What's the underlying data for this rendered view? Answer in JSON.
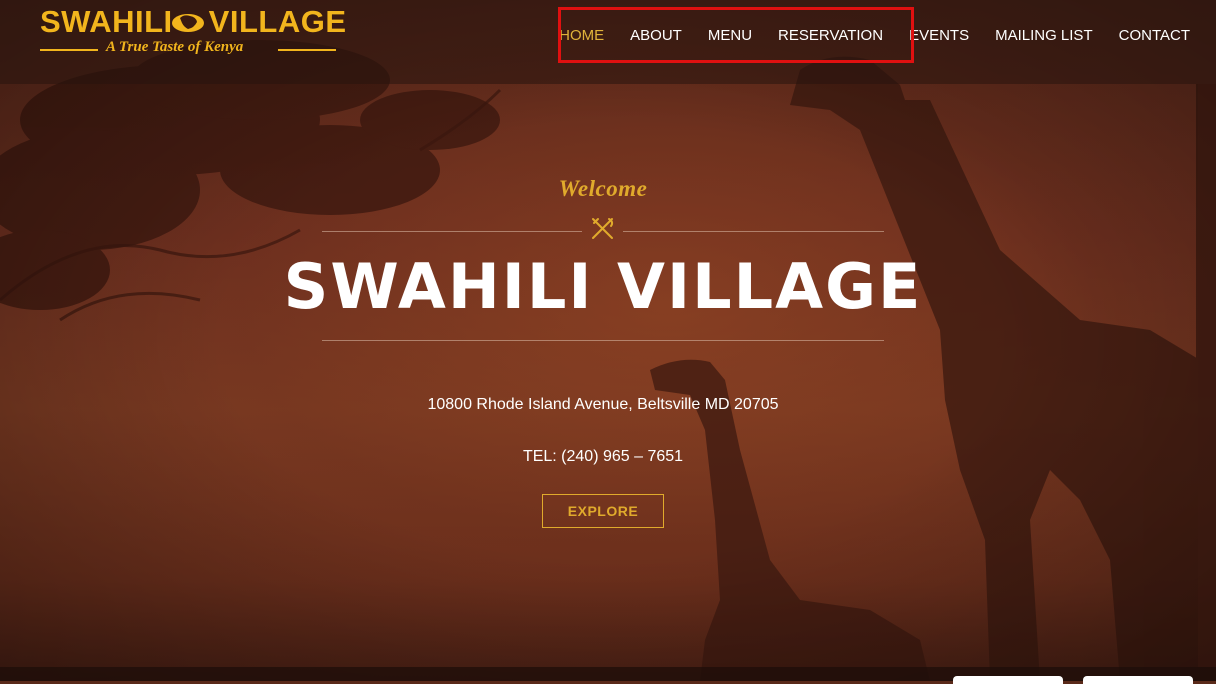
{
  "logo": {
    "title": "SWAHILI",
    "title2": "VILLAGE",
    "tagline": "A True Taste of Kenya"
  },
  "nav": {
    "items": [
      {
        "label": "HOME",
        "active": true
      },
      {
        "label": "ABOUT"
      },
      {
        "label": "MENU"
      },
      {
        "label": "RESERVATION"
      },
      {
        "label": "EVENTS"
      },
      {
        "label": "MAILING LIST"
      },
      {
        "label": "CONTACT"
      }
    ]
  },
  "hero": {
    "welcome": "Welcome",
    "title": "SWAHILI VILLAGE",
    "address": "10800 Rhode Island Avenue, Beltsville MD 20705",
    "tel": "TEL: (240) 965 – 7651",
    "explore_label": "EXPLORE"
  },
  "colors": {
    "accent": "#e0aa2c",
    "logo": "#f2b51d",
    "highlight": "#e01010"
  }
}
